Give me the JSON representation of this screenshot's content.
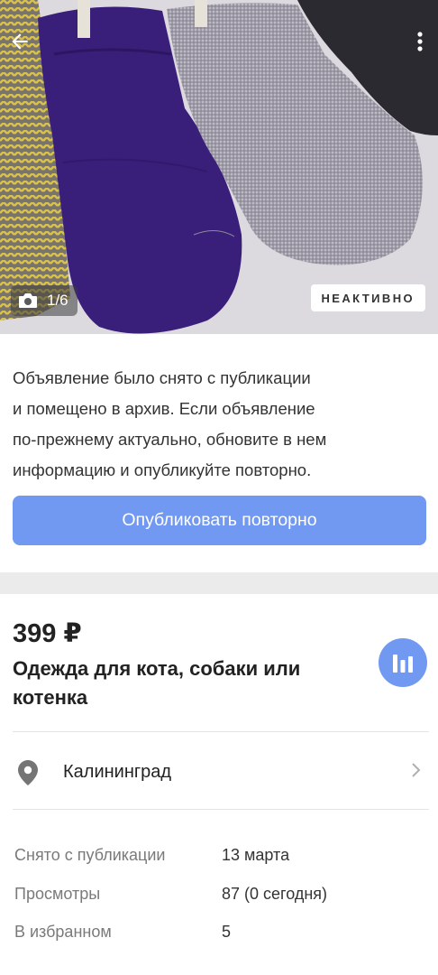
{
  "gallery": {
    "photo_counter": "1/6",
    "status_badge": "НЕАКТИВНО",
    "icons": {
      "back": "arrow-back-icon",
      "menu": "more-vertical-icon",
      "camera": "camera-icon"
    }
  },
  "notice": {
    "line1": "Объявление было снято с публикации",
    "line2": "и помещено в архив. Если объявление",
    "line3": "по-прежнему актуально, обновите в нем",
    "line4": "информацию и опубликуйте повторно."
  },
  "republish_button": "Опубликовать повторно",
  "listing": {
    "price": "399 ₽",
    "title_line1": "Одежда для кота, собаки или",
    "title_line2": "котенка"
  },
  "location": {
    "city": "Калининград"
  },
  "stats": [
    {
      "label": "Снято с публикации",
      "value": "13 марта"
    },
    {
      "label": "Просмотры",
      "value": "87 (0 сегодня)"
    },
    {
      "label": "В избранном",
      "value": "5"
    }
  ],
  "colors": {
    "accent": "#7199f2",
    "divider": "#ebebeb"
  }
}
